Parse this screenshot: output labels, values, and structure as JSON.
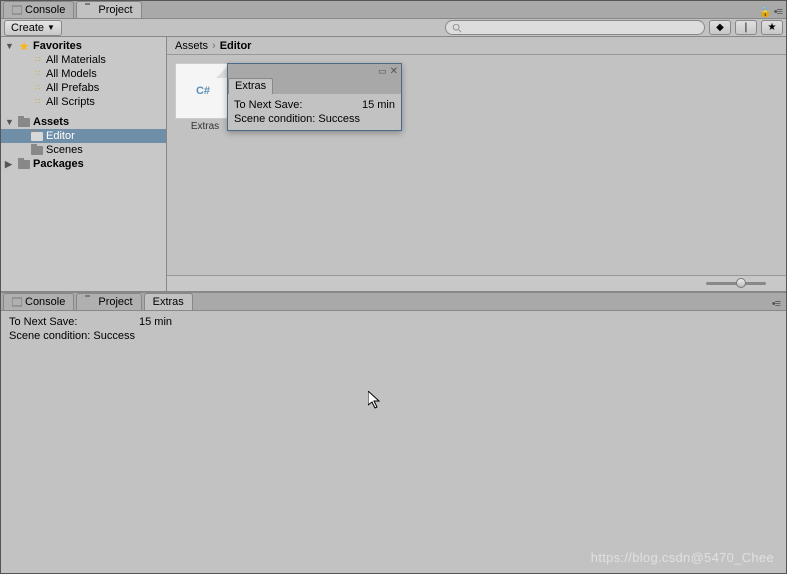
{
  "topTabs": {
    "console": "Console",
    "project": "Project"
  },
  "toolbar": {
    "create": "Create"
  },
  "tree": {
    "favorites": {
      "label": "Favorites",
      "items": [
        "All Materials",
        "All Models",
        "All Prefabs",
        "All Scripts"
      ]
    },
    "assets": {
      "label": "Assets",
      "items": [
        "Editor",
        "Scenes"
      ]
    },
    "packages": {
      "label": "Packages"
    }
  },
  "breadcrumb": {
    "root": "Assets",
    "current": "Editor"
  },
  "asset": {
    "label": "Extras",
    "badge": "C#"
  },
  "floatWin": {
    "title": "Extras",
    "rows": [
      {
        "label": "To Next Save:",
        "value": "15 min"
      },
      {
        "label": "Scene condition: Success",
        "value": ""
      }
    ]
  },
  "bottomTabs": {
    "console": "Console",
    "project": "Project",
    "extras": "Extras"
  },
  "bottomContent": {
    "rows": [
      {
        "label": "To Next Save:",
        "value": "15 min"
      },
      {
        "label": "Scene condition: Success",
        "value": ""
      }
    ]
  },
  "watermark": "https://blog.csdn@5470_Chee"
}
